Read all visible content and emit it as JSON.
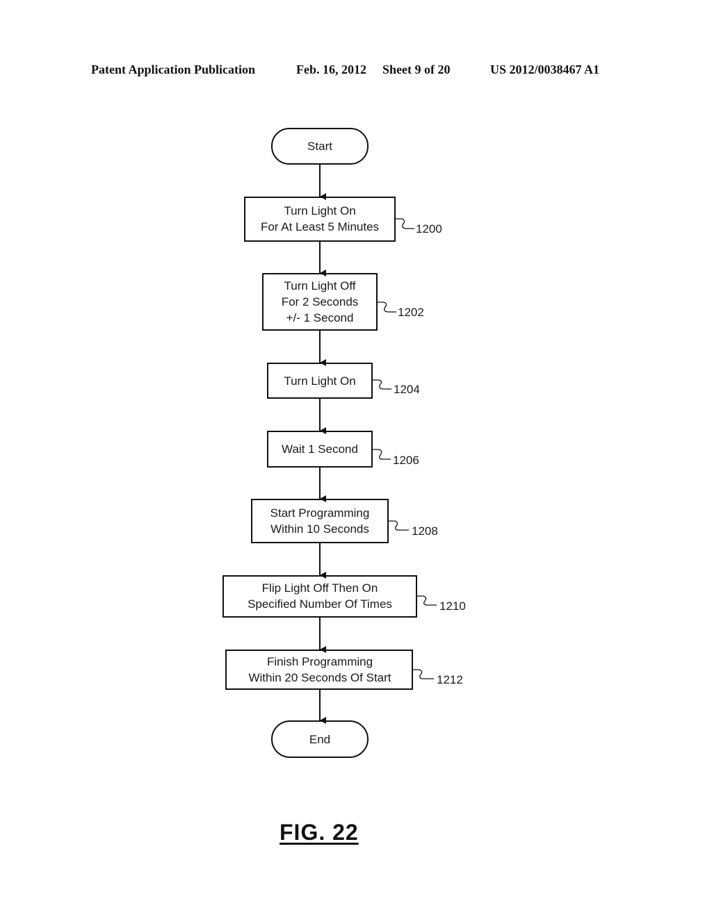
{
  "header": {
    "publication": "Patent Application Publication",
    "date": "Feb. 16, 2012",
    "sheet": "Sheet 9 of 20",
    "number": "US 2012/0038467 A1"
  },
  "flowchart": {
    "start": "Start",
    "end": "End",
    "steps": [
      {
        "ref": "1200",
        "lines": [
          "Turn Light On",
          "For At Least 5 Minutes"
        ]
      },
      {
        "ref": "1202",
        "lines": [
          "Turn Light Off",
          "For 2 Seconds",
          "+/- 1 Second"
        ]
      },
      {
        "ref": "1204",
        "lines": [
          "Turn Light On"
        ]
      },
      {
        "ref": "1206",
        "lines": [
          "Wait 1 Second"
        ]
      },
      {
        "ref": "1208",
        "lines": [
          "Start Programming",
          "Within 10 Seconds"
        ]
      },
      {
        "ref": "1210",
        "lines": [
          "Flip Light Off Then On",
          "Specified Number Of Times"
        ]
      },
      {
        "ref": "1212",
        "lines": [
          "Finish Programming",
          "Within 20 Seconds Of Start"
        ]
      }
    ]
  },
  "figure_label": "FIG. 22"
}
